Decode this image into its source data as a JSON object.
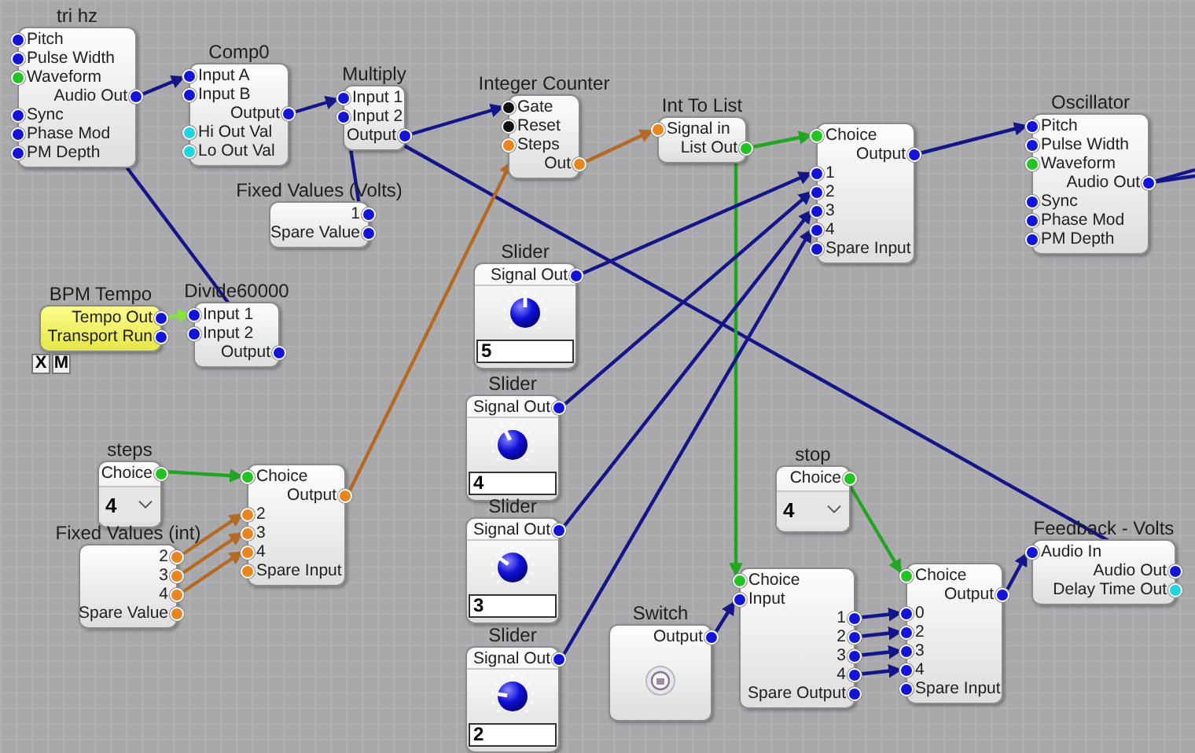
{
  "nodes": [
    {
      "kind": "module",
      "title": "tri hz",
      "pins": [
        {
          "label": "Pitch",
          "kind": "in",
          "color": "#1414d8"
        },
        {
          "label": "Pulse Width",
          "kind": "in",
          "color": "#1414d8"
        },
        {
          "label": "Waveform",
          "kind": "in",
          "color": "#22c322"
        },
        {
          "label": "Audio Out",
          "kind": "out",
          "color": "#1414d8"
        },
        {
          "label": "Sync",
          "kind": "in",
          "color": "#1414d8"
        },
        {
          "label": "Phase Mod",
          "kind": "in",
          "color": "#1414d8"
        },
        {
          "label": "PM Depth",
          "kind": "in",
          "color": "#1414d8"
        }
      ]
    },
    {
      "kind": "module",
      "title": "Comp0",
      "pins": [
        {
          "label": "Input A",
          "kind": "in",
          "color": "#1414d8"
        },
        {
          "label": "Input B",
          "kind": "in",
          "color": "#1414d8"
        },
        {
          "label": "Output",
          "kind": "out",
          "color": "#1414d8"
        },
        {
          "label": "Hi Out Val",
          "kind": "in",
          "color": "#22d4e0"
        },
        {
          "label": "Lo Out Val",
          "kind": "in",
          "color": "#22d4e0"
        }
      ]
    },
    {
      "kind": "module",
      "title": "Multiply",
      "pins": [
        {
          "label": "Input 1",
          "kind": "in",
          "color": "#1414d8"
        },
        {
          "label": "Input 2",
          "kind": "in",
          "color": "#1414d8"
        },
        {
          "label": "Output",
          "kind": "out",
          "color": "#1414d8"
        }
      ]
    },
    {
      "kind": "module",
      "title": "Fixed Values (Volts)",
      "pins": [
        {
          "label": "1",
          "kind": "out",
          "color": "#1414d8"
        },
        {
          "label": "Spare Value",
          "kind": "out",
          "color": "#1414d8"
        }
      ]
    },
    {
      "kind": "host",
      "title": "BPM Tempo",
      "pins": [
        {
          "label": "Tempo Out",
          "kind": "out",
          "color": "#1414d8"
        },
        {
          "label": "Transport Run",
          "kind": "out",
          "color": "#1414d8"
        }
      ],
      "buttons": [
        "X",
        "M"
      ]
    },
    {
      "kind": "module",
      "title": "Divide60000",
      "pins": [
        {
          "label": "Input 1",
          "kind": "in",
          "color": "#1414d8"
        },
        {
          "label": "Input 2",
          "kind": "in",
          "color": "#1414d8"
        },
        {
          "label": "Output",
          "kind": "out",
          "color": "#1414d8"
        }
      ]
    },
    {
      "kind": "module",
      "title": "Integer Counter",
      "pins": [
        {
          "label": "Gate",
          "kind": "in",
          "color": "#111111"
        },
        {
          "label": "Reset",
          "kind": "in",
          "color": "#111111"
        },
        {
          "label": "Steps",
          "kind": "in",
          "color": "#e8861e"
        },
        {
          "label": "Out",
          "kind": "out",
          "color": "#e8861e"
        }
      ]
    },
    {
      "kind": "module",
      "title": "Int To List",
      "pins": [
        {
          "label": "Signal in",
          "kind": "in",
          "color": "#e8861e"
        },
        {
          "label": "List Out",
          "kind": "out",
          "color": "#22c322"
        }
      ]
    },
    {
      "kind": "module",
      "pins": [
        {
          "label": "Choice",
          "kind": "in",
          "color": "#22c322"
        },
        {
          "label": "Output",
          "kind": "out",
          "color": "#1414d8"
        },
        {
          "label": "1",
          "kind": "in",
          "color": "#1414d8"
        },
        {
          "label": "2",
          "kind": "in",
          "color": "#1414d8"
        },
        {
          "label": "3",
          "kind": "in",
          "color": "#1414d8"
        },
        {
          "label": "4",
          "kind": "in",
          "color": "#1414d8"
        },
        {
          "label": "Spare Input",
          "kind": "in",
          "color": "#1414d8"
        }
      ]
    },
    {
      "kind": "module",
      "title": "Oscillator",
      "pins": [
        {
          "label": "Pitch",
          "kind": "in",
          "color": "#1414d8"
        },
        {
          "label": "Pulse Width",
          "kind": "in",
          "color": "#1414d8"
        },
        {
          "label": "Waveform",
          "kind": "in",
          "color": "#22c322"
        },
        {
          "label": "Audio Out",
          "kind": "out",
          "color": "#1414d8"
        },
        {
          "label": "Sync",
          "kind": "in",
          "color": "#1414d8"
        },
        {
          "label": "Phase Mod",
          "kind": "in",
          "color": "#1414d8"
        },
        {
          "label": "PM Depth",
          "kind": "in",
          "color": "#1414d8"
        }
      ]
    },
    {
      "kind": "slider",
      "title": "Slider",
      "pins": [
        {
          "label": "Signal Out",
          "kind": "out",
          "color": "#1414d8"
        }
      ],
      "level": 0.5,
      "value": "5"
    },
    {
      "kind": "slider",
      "title": "Slider",
      "pins": [
        {
          "label": "Signal Out",
          "kind": "out",
          "color": "#1414d8"
        }
      ],
      "level": 0.4,
      "value": "4"
    },
    {
      "kind": "slider",
      "title": "Slider",
      "pins": [
        {
          "label": "Signal Out",
          "kind": "out",
          "color": "#1414d8"
        }
      ],
      "level": 0.3,
      "value": "3"
    },
    {
      "kind": "slider",
      "title": "Slider",
      "pins": [
        {
          "label": "Signal Out",
          "kind": "out",
          "color": "#1414d8"
        }
      ],
      "level": 0.2,
      "value": "2"
    },
    {
      "kind": "dropdown",
      "title": "steps",
      "pins": [
        {
          "label": "Choice",
          "kind": "out",
          "color": "#22c322"
        }
      ],
      "value": "4"
    },
    {
      "kind": "module",
      "title": "Fixed Values (int)",
      "pins": [
        {
          "label": "2",
          "kind": "out",
          "color": "#e8861e"
        },
        {
          "label": "3",
          "kind": "out",
          "color": "#e8861e"
        },
        {
          "label": "4",
          "kind": "out",
          "color": "#e8861e"
        },
        {
          "label": "Spare Value",
          "kind": "out",
          "color": "#e8861e"
        }
      ]
    },
    {
      "kind": "module",
      "pins": [
        {
          "label": "Choice",
          "kind": "in",
          "color": "#22c322"
        },
        {
          "label": "Output",
          "kind": "out",
          "color": "#e8861e"
        },
        {
          "label": "2",
          "kind": "in",
          "color": "#e8861e"
        },
        {
          "label": "3",
          "kind": "in",
          "color": "#e8861e"
        },
        {
          "label": "4",
          "kind": "in",
          "color": "#e8861e"
        },
        {
          "label": "Spare Input",
          "kind": "in",
          "color": "#e8861e"
        }
      ]
    },
    {
      "kind": "dropdown",
      "title": "stop",
      "pins": [
        {
          "label": "Choice",
          "kind": "out",
          "color": "#22c322"
        }
      ],
      "value": "4"
    },
    {
      "kind": "switch",
      "title": "Switch",
      "pins": [
        {
          "label": "Output",
          "kind": "out",
          "color": "#1414d8"
        }
      ]
    },
    {
      "kind": "module",
      "pins": [
        {
          "label": "Choice",
          "kind": "in",
          "color": "#22c322"
        },
        {
          "label": "Input",
          "kind": "in",
          "color": "#1414d8"
        },
        {
          "label": "1",
          "kind": "out",
          "color": "#1414d8"
        },
        {
          "label": "2",
          "kind": "out",
          "color": "#1414d8"
        },
        {
          "label": "3",
          "kind": "out",
          "color": "#1414d8"
        },
        {
          "label": "4",
          "kind": "out",
          "color": "#1414d8"
        },
        {
          "label": "Spare Output",
          "kind": "out",
          "color": "#1414d8"
        }
      ]
    },
    {
      "kind": "module",
      "pins": [
        {
          "label": "Choice",
          "kind": "in",
          "color": "#22c322"
        },
        {
          "label": "Output",
          "kind": "out",
          "color": "#1414d8"
        },
        {
          "label": "0",
          "kind": "in",
          "color": "#1414d8"
        },
        {
          "label": "2",
          "kind": "in",
          "color": "#1414d8"
        },
        {
          "label": "3",
          "kind": "in",
          "color": "#1414d8"
        },
        {
          "label": "4",
          "kind": "in",
          "color": "#1414d8"
        },
        {
          "label": "Spare Input",
          "kind": "in",
          "color": "#1414d8"
        }
      ]
    },
    {
      "kind": "module",
      "title": "Feedback - Volts",
      "pins": [
        {
          "label": "Audio In",
          "kind": "in",
          "color": "#1414d8"
        },
        {
          "label": "Audio Out",
          "kind": "out",
          "color": "#1414d8"
        },
        {
          "label": "Delay Time Out",
          "kind": "out",
          "color": "#22d4e0"
        }
      ]
    }
  ]
}
